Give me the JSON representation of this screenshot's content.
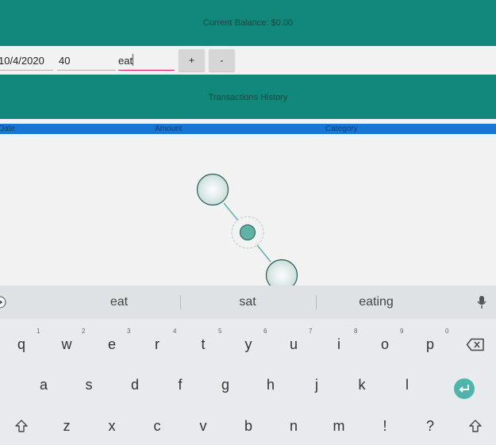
{
  "balance": {
    "text": "Current Balance: $0.00"
  },
  "inputs": {
    "date_value": "10/4/2020",
    "amount_value": "40",
    "category_value": "eat"
  },
  "buttons": {
    "add_label": "+",
    "subtract_label": "-"
  },
  "transactions": {
    "title": "Transactions History",
    "columns": [
      "Date",
      "Amount",
      "Category"
    ]
  },
  "keyboard": {
    "suggestions": [
      "eat",
      "sat",
      "eating"
    ],
    "row1": [
      "q",
      "w",
      "e",
      "r",
      "t",
      "y",
      "u",
      "i",
      "o",
      "p"
    ],
    "row1_numbers": [
      "1",
      "2",
      "3",
      "4",
      "5",
      "6",
      "7",
      "8",
      "9",
      "0"
    ],
    "row2": [
      "a",
      "s",
      "d",
      "f",
      "g",
      "h",
      "j",
      "k",
      "l"
    ],
    "row3": [
      "z",
      "x",
      "c",
      "v",
      "b",
      "n",
      "m",
      "!",
      "?"
    ]
  },
  "colors": {
    "header": "#10887a",
    "column_header": "#1976d2",
    "accent": "#d81b60",
    "enter_key": "#4db6ac"
  },
  "icons": [
    "expand-arrow-icon",
    "mic-icon",
    "backspace-icon",
    "enter-icon",
    "shift-icon",
    "gesture-touch-icon"
  ]
}
